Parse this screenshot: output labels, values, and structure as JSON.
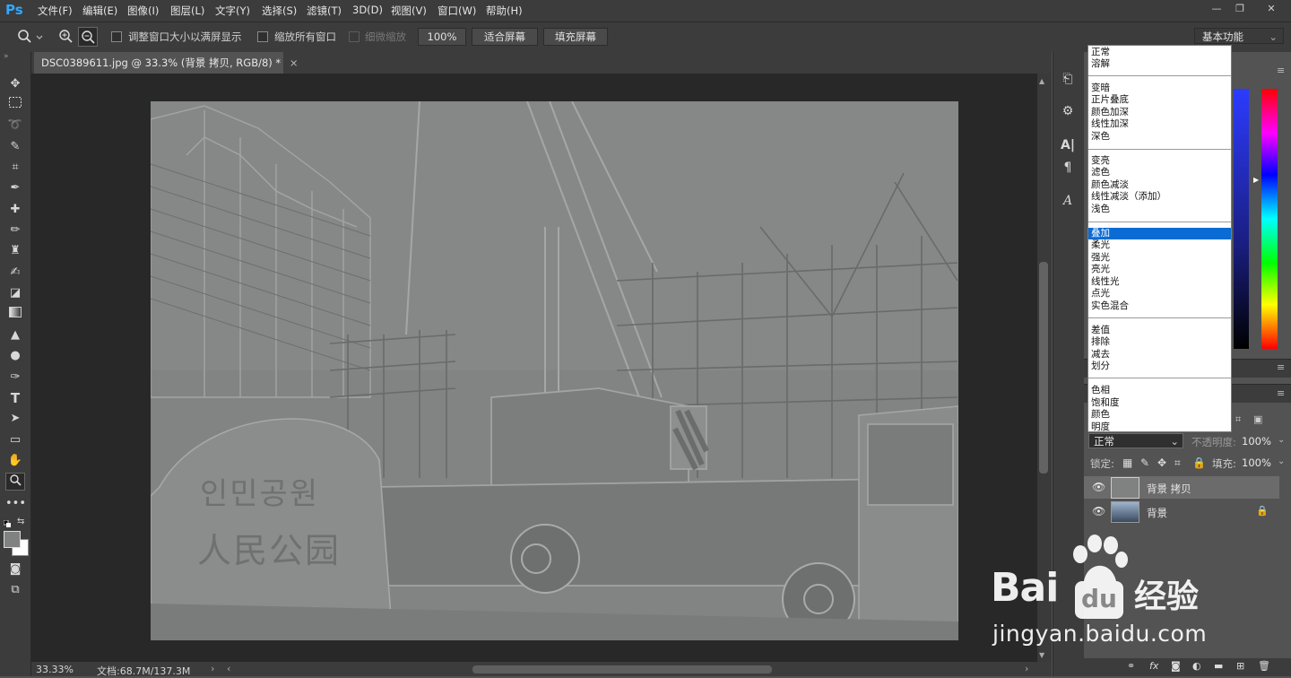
{
  "app": {
    "logo": "Ps",
    "menu": [
      "文件(F)",
      "编辑(E)",
      "图像(I)",
      "图层(L)",
      "文字(Y)",
      "选择(S)",
      "滤镜(T)",
      "3D(D)",
      "视图(V)",
      "窗口(W)",
      "帮助(H)"
    ],
    "window_controls": [
      "—",
      "❐",
      "✕"
    ]
  },
  "options": {
    "tool_glyph": "🔍",
    "resize_windows": "调整窗口大小以满屏显示",
    "zoom_all": "缩放所有窗口",
    "scrubby_zoom": "细微缩放",
    "zoom_value": "100%",
    "fit_screen": "适合屏幕",
    "fill_screen": "填充屏幕",
    "workspace": "基本功能"
  },
  "document": {
    "tab_title": "DSC0389611.jpg @ 33.3% (背景 拷贝, RGB/8) *",
    "tab_close": "×",
    "zoom_status": "33.33%",
    "doc_size": "文档:68.7M/137.3M",
    "stone_text_1": "인민공원",
    "stone_text_2": "人民公园"
  },
  "blend_modes": {
    "groups": [
      [
        "正常",
        "溶解"
      ],
      [
        "变暗",
        "正片叠底",
        "颜色加深",
        "线性加深",
        "深色"
      ],
      [
        "变亮",
        "滤色",
        "颜色减淡",
        "线性减淡（添加）",
        "浅色"
      ],
      [
        "叠加",
        "柔光",
        "强光",
        "亮光",
        "线性光",
        "点光",
        "实色混合"
      ],
      [
        "差值",
        "排除",
        "减去",
        "划分"
      ],
      [
        "色相",
        "饱和度",
        "颜色",
        "明度"
      ]
    ],
    "selected": "叠加"
  },
  "layers_panel": {
    "blend_value": "正常",
    "opacity_label": "不透明度:",
    "opacity_value": "100%",
    "lock_label": "锁定:",
    "fill_label": "填充:",
    "fill_value": "100%",
    "layers": [
      {
        "name": "背景 拷贝",
        "locked": false
      },
      {
        "name": "背景",
        "locked": true
      }
    ]
  },
  "watermark": {
    "brand": "Bai",
    "brand_du": "du",
    "brand_cn": "经验",
    "url": "jingyan.baidu.com"
  }
}
